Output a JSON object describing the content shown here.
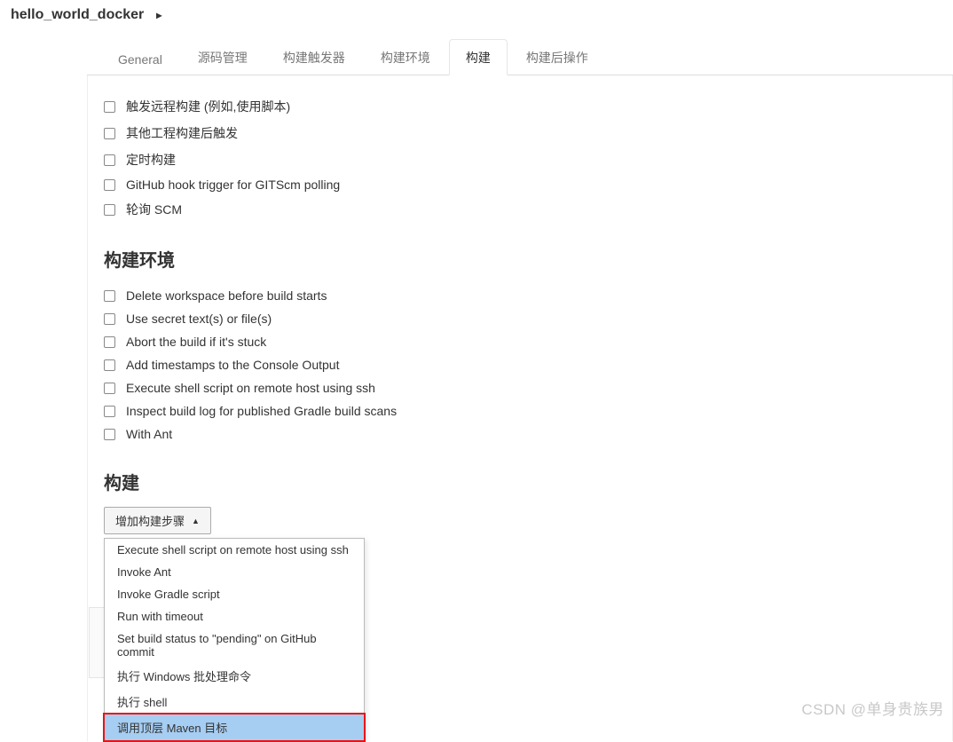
{
  "breadcrumb": {
    "title": "hello_world_docker"
  },
  "tabs": [
    {
      "label": "General",
      "active": false
    },
    {
      "label": "源码管理",
      "active": false
    },
    {
      "label": "构建触发器",
      "active": false
    },
    {
      "label": "构建环境",
      "active": false
    },
    {
      "label": "构建",
      "active": true
    },
    {
      "label": "构建后操作",
      "active": false
    }
  ],
  "triggers": {
    "items": [
      "触发远程构建 (例如,使用脚本)",
      "其他工程构建后触发",
      "定时构建",
      "GitHub hook trigger for GITScm polling",
      "轮询 SCM"
    ]
  },
  "build_env": {
    "heading": "构建环境",
    "items": [
      "Delete workspace before build starts",
      "Use secret text(s) or file(s)",
      "Abort the build if it's stuck",
      "Add timestamps to the Console Output",
      "Execute shell script on remote host using ssh",
      "Inspect build log for published Gradle build scans",
      "With Ant"
    ]
  },
  "build": {
    "heading": "构建",
    "add_step_label": "增加构建步骤",
    "dropdown": [
      "Execute shell script on remote host using ssh",
      "Invoke Ant",
      "Invoke Gradle script",
      "Run with timeout",
      "Set build status to \"pending\" on GitHub commit",
      "执行 Windows 批处理命令",
      "执行 shell",
      "调用顶层 Maven 目标"
    ],
    "highlight_index": 7
  },
  "watermark": "CSDN @单身贵族男"
}
